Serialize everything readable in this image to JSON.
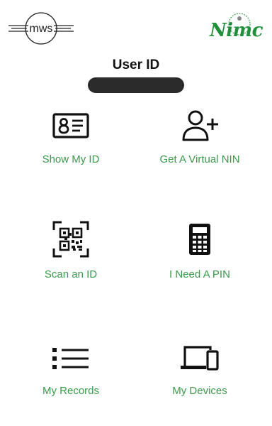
{
  "header": {
    "left_logo": {
      "text": "mws",
      "icon": "mws-logo"
    },
    "right_logo": {
      "text": "Nimc",
      "icon": "nimc-logo"
    }
  },
  "user": {
    "title": "User ID",
    "id_redacted": true
  },
  "tiles": [
    {
      "label": "Show My ID",
      "icon": "id-card-icon"
    },
    {
      "label": "Get A Virtual NIN",
      "icon": "add-user-icon"
    },
    {
      "label": "Scan an ID",
      "icon": "qr-scan-icon"
    },
    {
      "label": "I Need A PIN",
      "icon": "calculator-icon"
    },
    {
      "label": "My Records",
      "icon": "list-icon"
    },
    {
      "label": "My Devices",
      "icon": "devices-icon"
    }
  ],
  "colors": {
    "label": "#3a9a4a",
    "logo_green": "#1f8f3a",
    "icon": "#111111",
    "redaction": "#2b2b2b"
  }
}
